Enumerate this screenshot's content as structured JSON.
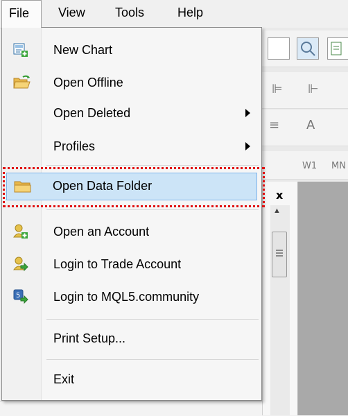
{
  "menubar": {
    "file": "File",
    "view": "View",
    "tools": "Tools",
    "help": "Help"
  },
  "file_menu": {
    "items": [
      {
        "label": "New Chart",
        "icon": "new-chart-icon"
      },
      {
        "label": "Open Offline",
        "icon": "open-folder-icon"
      },
      {
        "label": "Open Deleted",
        "submenu": true
      },
      {
        "label": "Profiles",
        "submenu": true
      },
      {
        "label": "Open Data Folder",
        "icon": "folder-icon",
        "highlighted": true
      },
      {
        "label": "Open an Account",
        "icon": "account-add-icon"
      },
      {
        "label": "Login to Trade Account",
        "icon": "account-login-icon"
      },
      {
        "label": "Login to MQL5.community",
        "icon": "mql5-login-icon"
      },
      {
        "label": "Print Setup..."
      },
      {
        "label": "Exit"
      }
    ]
  },
  "background": {
    "tool_letter": "A",
    "timeframe_w1": "W1",
    "timeframe_mn": "MN",
    "panel_close": "x"
  },
  "colors": {
    "highlight_bg": "#cce4f7",
    "highlight_border": "#7eb4ea",
    "focus_ring": "#e01010"
  }
}
